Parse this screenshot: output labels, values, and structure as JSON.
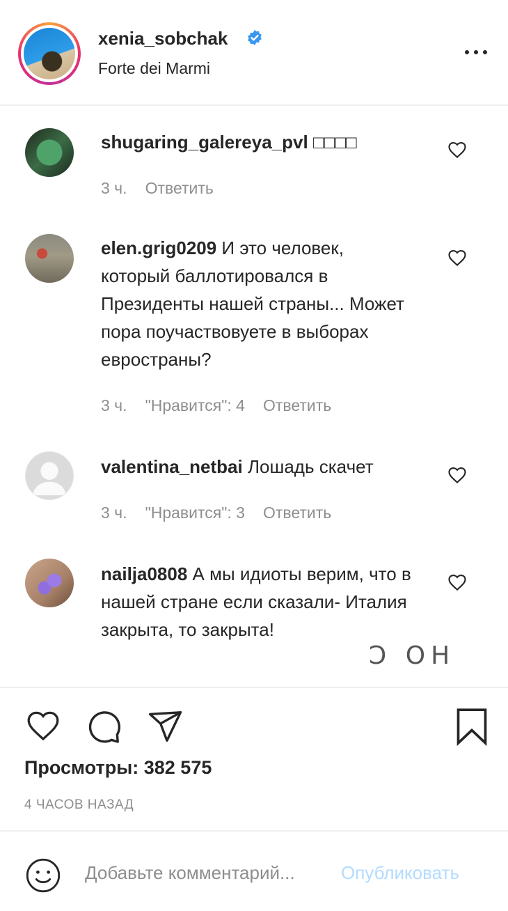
{
  "post_header": {
    "username": "xenia_sobchak",
    "location": "Forte dei Marmi",
    "verified": true
  },
  "comments": [
    {
      "username": "shugaring_galereya_pvl",
      "text": " □□□□",
      "time": "3 ч.",
      "likes": "",
      "reply": "Ответить"
    },
    {
      "username": "elen.grig0209",
      "text": " И это человек, который баллотировался в Президенты нашей страны... Может пора поучаствовуете в выборах евространы?",
      "time": "3 ч.",
      "likes": "\"Нравится\": 4",
      "reply": "Ответить"
    },
    {
      "username": "valentina_netbai",
      "text": " Лошадь скачет",
      "time": "3 ч.",
      "likes": "\"Нравится\": 3",
      "reply": "Ответить"
    },
    {
      "username": "nailja0808",
      "text": " А мы идиоты верим, что в нашей стране если сказали- Италия закрыта, то закрыта!",
      "time": "",
      "likes": "",
      "reply": ""
    }
  ],
  "overlay_glyphs": "Ͻ ОН",
  "footer": {
    "views": "Просмотры: 382 575",
    "time_ago": "4 ЧАСОВ НАЗАД"
  },
  "comment_bar": {
    "placeholder": "Добавьте комментарий...",
    "publish_label": "Опубликовать"
  },
  "colors": {
    "verified_blue": "#3897f0",
    "muted_text": "#8e8e8e",
    "publish_disabled": "#b3dbff"
  }
}
